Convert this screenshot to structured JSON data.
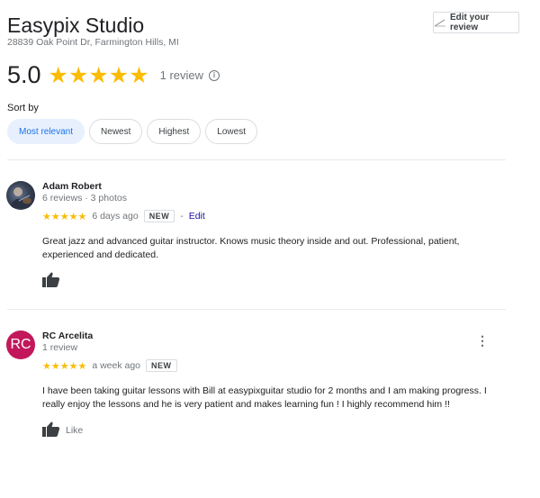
{
  "business": {
    "name": "Easypix Studio",
    "address": "28839 Oak Point Dr, Farmington Hills, MI"
  },
  "edit_review_button": {
    "label": "Edit your review",
    "icon": "pencil-icon"
  },
  "summary": {
    "rating": "5.0",
    "stars": "★★★★★",
    "rating_value": 5,
    "review_count": "1 review",
    "info_icon": "ⓘ"
  },
  "sort": {
    "label": "Sort by",
    "options": [
      "Most relevant",
      "Newest",
      "Highest",
      "Lowest"
    ],
    "selected": "Most relevant"
  },
  "reviews": [
    {
      "name": "Adam Robert",
      "meta": "6 reviews · 3 photos",
      "stars": "★★★★★",
      "rating": 5,
      "time": "6 days ago",
      "badge": "NEW",
      "separator": "-",
      "edit_label": "Edit",
      "text": "Great jazz and advanced guitar instructor. Knows music theory inside and out. Professional, patient, experienced and dedicated.",
      "like_label": ""
    },
    {
      "name": "RC Arcelita",
      "avatar_initials": "RC",
      "meta": "1 review",
      "stars": "★★★★★",
      "rating": 5,
      "time": "a week ago",
      "badge": "NEW",
      "text": "I have been taking guitar lessons with Bill at easypixguitar  studio for 2 months and I am making progress. I really enjoy the lessons and he is very patient and makes learning fun ! I highly recommend him !!",
      "like_label": "Like",
      "more_icon": "⋮"
    }
  ],
  "colors": {
    "star": "#fbbc04",
    "selected_chip_bg": "#e8f0fe",
    "selected_chip_text": "#1a73e8",
    "link": "#1a0dab",
    "avatar_rc": "#c2185b"
  }
}
